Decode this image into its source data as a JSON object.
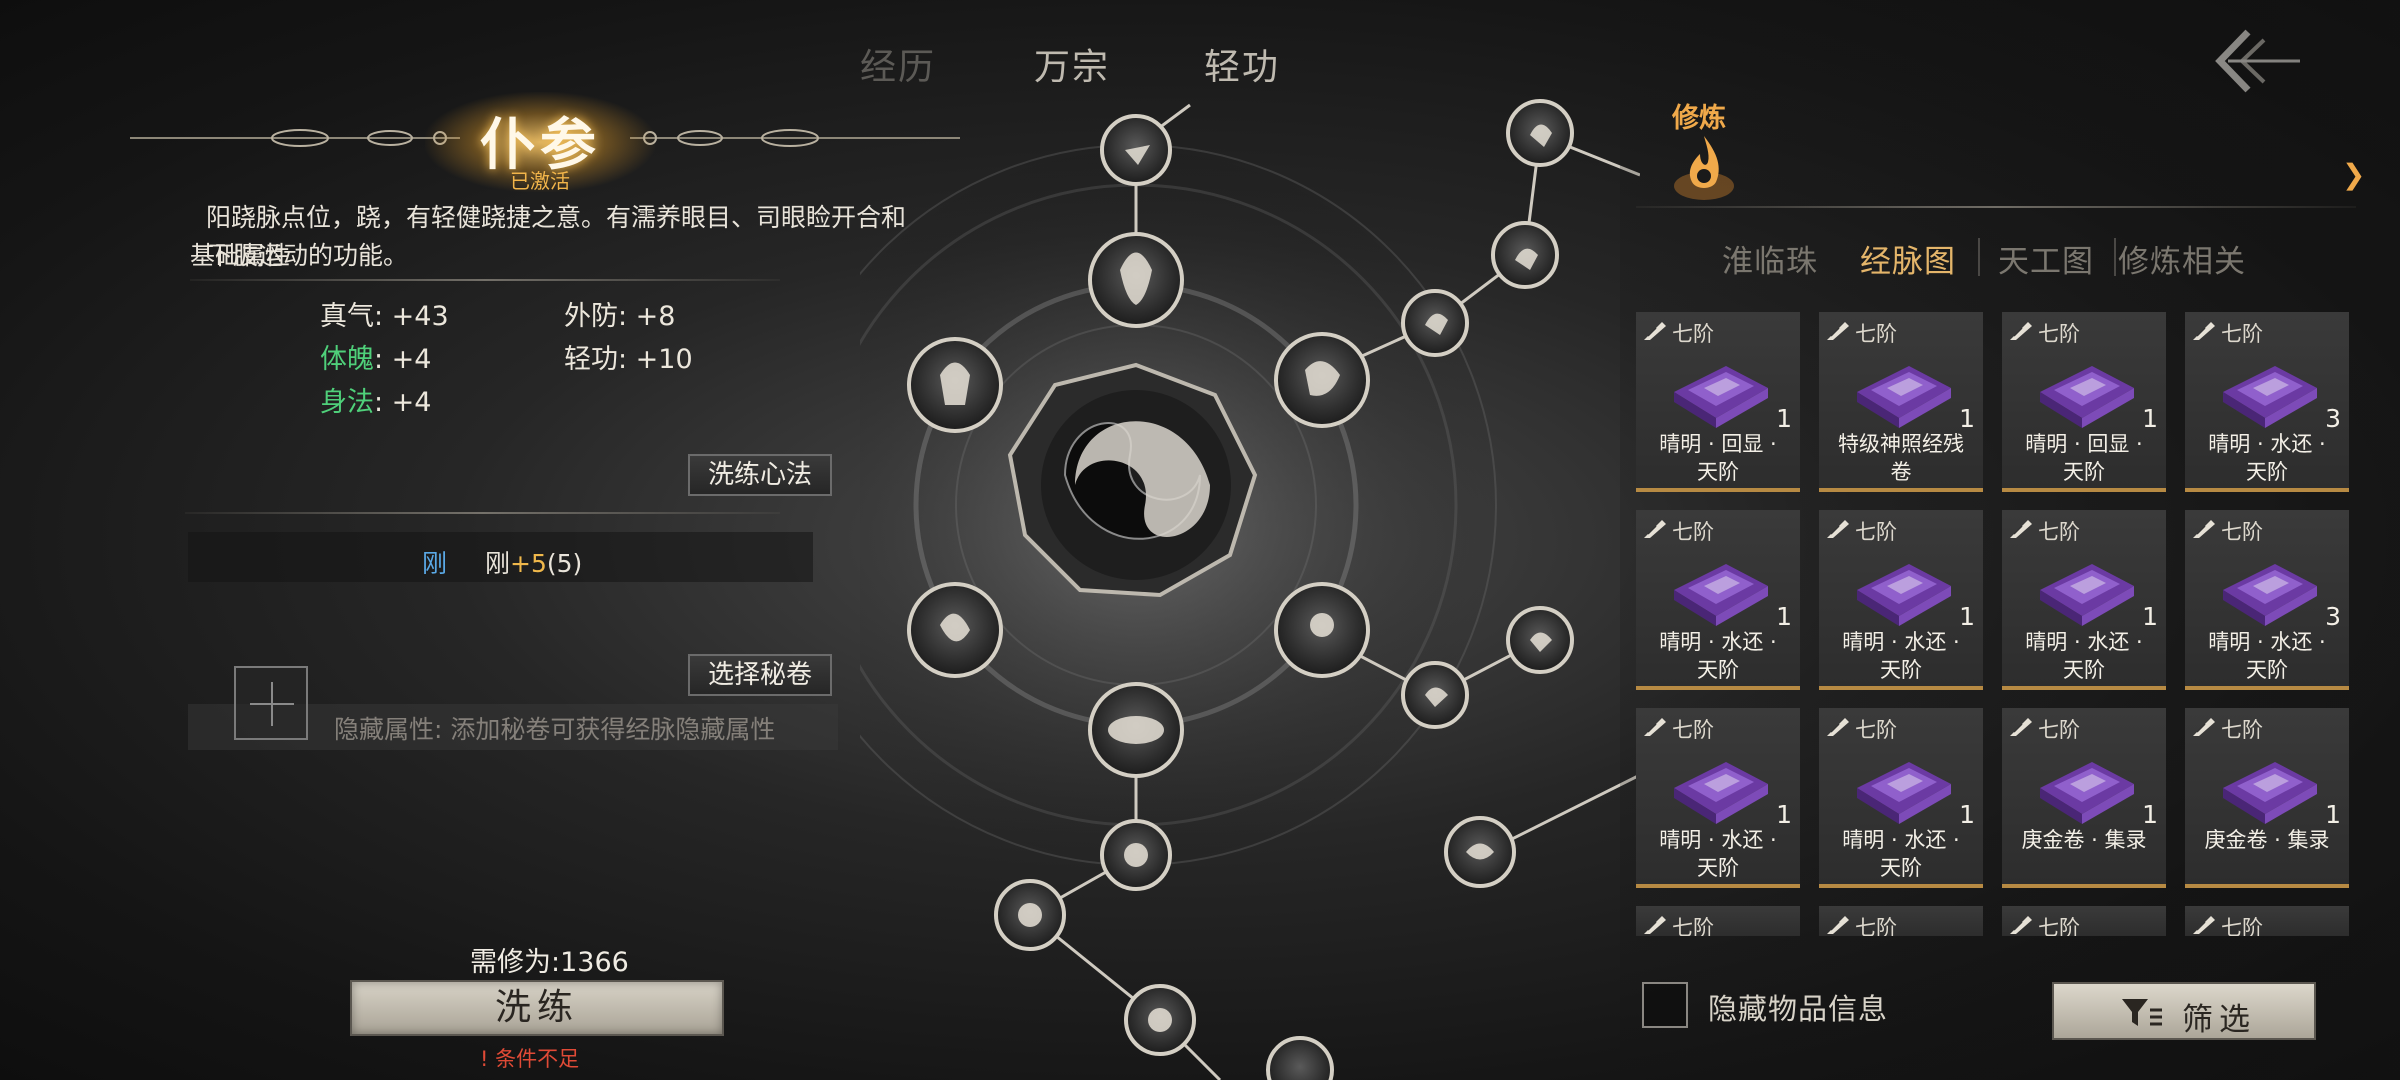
{
  "top_tabs": [
    "经历",
    "万宗",
    "轻功"
  ],
  "left": {
    "title": "仆参",
    "status": "已激活",
    "description": "阳跷脉点位，跷，有轻健跷捷之意。有濡养眼目、司眼睑开合和",
    "description_line2_overlap_a": "基础属性",
    "description_line2_overlap_b": "下肢运动的功能。",
    "stats": [
      {
        "name": "真气",
        "value": ": +43",
        "color": "#ece7dc"
      },
      {
        "name": "外防",
        "value": ": +8",
        "color": "#ece7dc"
      },
      {
        "name": "体魄",
        "value": ": +4",
        "color": "#4fd07a"
      },
      {
        "name": "轻功",
        "value": ": +10",
        "color": "#ece7dc"
      },
      {
        "name": "身法",
        "value": ": +4",
        "color": "#4fd07a"
      }
    ],
    "refine_method_button": "洗练心法",
    "gang_label": "刚",
    "gang_value_prefix": "刚",
    "gang_value_plus": "+5",
    "gang_value_suffix": "(5)",
    "select_scroll_button": "选择秘卷",
    "hidden_attr_text": "隐藏属性: 添加秘卷可获得经脉隐藏属性",
    "requirement": "需修为:1366",
    "wash_button": "洗练",
    "condition_text": "! 条件不足"
  },
  "right": {
    "section_label": "修炼",
    "sub_tabs": [
      "淮临珠",
      "经脉图",
      "天工图",
      "修炼相关"
    ],
    "active_sub_tab": "经脉图",
    "items": [
      {
        "grade": "七阶",
        "count": "1",
        "name": "晴明 · 回显 ·\n天阶"
      },
      {
        "grade": "七阶",
        "count": "1",
        "name": "特级神照经残\n卷"
      },
      {
        "grade": "七阶",
        "count": "1",
        "name": "晴明 · 回显 ·\n天阶"
      },
      {
        "grade": "七阶",
        "count": "3",
        "name": "晴明 · 水还 ·\n天阶"
      },
      {
        "grade": "七阶",
        "count": "1",
        "name": "晴明 · 水还 ·\n天阶"
      },
      {
        "grade": "七阶",
        "count": "1",
        "name": "晴明 · 水还 ·\n天阶"
      },
      {
        "grade": "七阶",
        "count": "1",
        "name": "晴明 · 水还 ·\n天阶"
      },
      {
        "grade": "七阶",
        "count": "3",
        "name": "晴明 · 水还 ·\n天阶"
      },
      {
        "grade": "七阶",
        "count": "1",
        "name": "晴明 · 水还 ·\n天阶"
      },
      {
        "grade": "七阶",
        "count": "1",
        "name": "晴明 · 水还 ·\n天阶"
      },
      {
        "grade": "七阶",
        "count": "1",
        "name": "庚金卷 · 集录"
      },
      {
        "grade": "七阶",
        "count": "1",
        "name": "庚金卷 · 集录"
      },
      {
        "grade": "七阶",
        "count": "",
        "name": ""
      },
      {
        "grade": "七阶",
        "count": "",
        "name": ""
      },
      {
        "grade": "七阶",
        "count": "",
        "name": ""
      },
      {
        "grade": "七阶",
        "count": "",
        "name": ""
      }
    ],
    "hide_info_label": "隐藏物品信息",
    "filter_button": "筛选"
  },
  "colors": {
    "accent_gold": "#f0a94a",
    "active_tab": "#e4b56a",
    "green_stat": "#4fd07a",
    "blue_gang": "#5aa9e6",
    "warning_red": "#e04a36",
    "book_purple": "#8a4fc4"
  }
}
